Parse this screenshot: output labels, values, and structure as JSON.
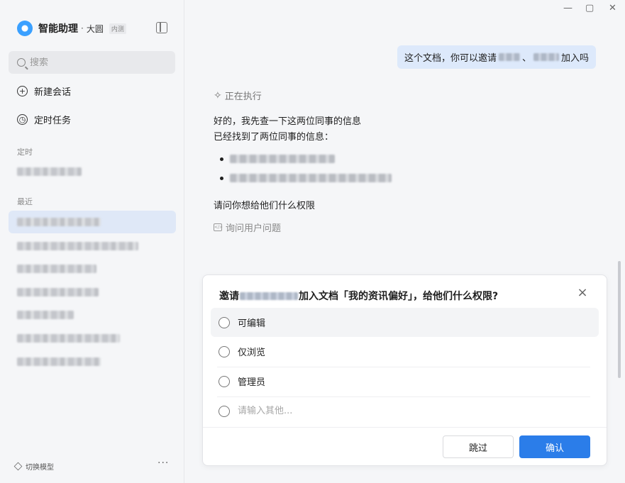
{
  "app": {
    "name": "智能助理",
    "user": "大圆",
    "badge": "内测"
  },
  "window": {
    "minimize": "—",
    "maximize": "▢",
    "close": "✕"
  },
  "sidebar": {
    "search_placeholder": "搜索",
    "new_chat": "新建会话",
    "scheduled": "定时任务",
    "section_scheduled": "定时",
    "section_recent": "最近",
    "switch_model": "切换模型",
    "more": "···"
  },
  "chat": {
    "user_message_prefix": "这个文档，你可以邀请",
    "user_message_separator": "、",
    "user_message_suffix": "加入吗",
    "status": "正在执行",
    "reply_line1": "好的，我先查一下这两位同事的信息",
    "reply_line2": "已经找到了两位同事的信息：",
    "reply_question": "请问你想给他们什么权限",
    "tool_label": "询问用户问题"
  },
  "dialog": {
    "title_prefix": "邀请",
    "title_suffix": "加入文档「我的资讯偏好」，给他们什么权限?",
    "options": [
      "可编辑",
      "仅浏览",
      "管理员"
    ],
    "other_placeholder": "请输入其他...",
    "skip_label": "跳过",
    "confirm_label": "确认"
  },
  "colors": {
    "accent": "#2b7de9",
    "user_bubble": "#dde9fb",
    "active_item": "#dfe8f7"
  }
}
